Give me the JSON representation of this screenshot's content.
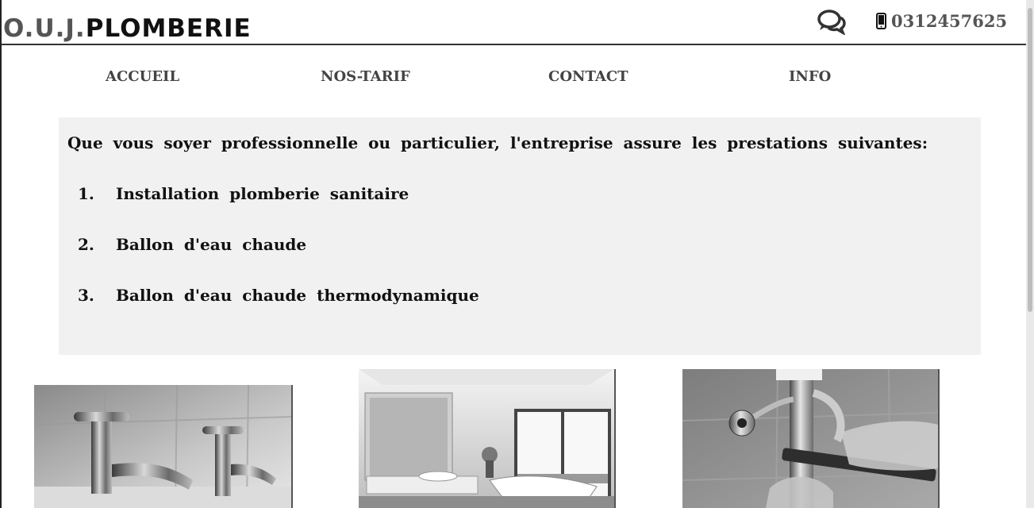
{
  "header": {
    "logo_prefix": "O.U.J.",
    "logo_main": "PLOMBERIE",
    "phone": "0312457625",
    "icons": [
      "chat-icon",
      "mobile-phone-icon"
    ]
  },
  "nav": {
    "items": [
      {
        "label": "ACCUEIL"
      },
      {
        "label": "NOS-TARIF"
      },
      {
        "label": "CONTACT"
      },
      {
        "label": "INFO"
      }
    ]
  },
  "services": {
    "intro": "Que vous soyer professionnelle ou particulier, l'entreprise assure les prestations suivantes:",
    "items": [
      {
        "num": "1.",
        "label": "Installation plomberie sanitaire"
      },
      {
        "num": "2.",
        "label": "Ballon d'eau chaude"
      },
      {
        "num": "3.",
        "label": "Ballon d'eau chaude thermodynamique"
      }
    ]
  },
  "gallery": {
    "images": [
      "faucet-photo",
      "bathroom-photo",
      "plumber-pipe-photo"
    ]
  },
  "colors": {
    "panel_bg": "#f1f1f1",
    "nav_text": "#444444",
    "phone_text": "#555555",
    "border": "#333333"
  }
}
